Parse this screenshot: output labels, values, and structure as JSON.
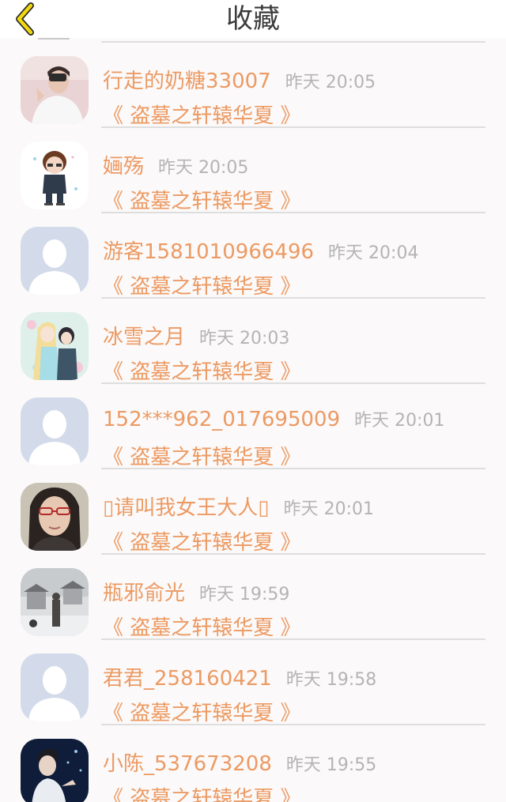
{
  "header": {
    "title": "收藏",
    "back_icon": "chevron-left-icon",
    "accent": "#f2d80f"
  },
  "colors": {
    "name": "#ec9a63",
    "time": "#b4b4b4",
    "separator": "#dedede"
  },
  "items": [
    {
      "name": "行走的奶糖33007",
      "time": "昨天 20:05",
      "book": "《 盗墓之轩辕华夏 》",
      "avatar": "photo-avatar"
    },
    {
      "name": "婳殇",
      "time": "昨天 20:05",
      "book": "《 盗墓之轩辕华夏 》",
      "avatar": "cartoon-avatar"
    },
    {
      "name": "游客1581010966496",
      "time": "昨天 20:04",
      "book": "《 盗墓之轩辕华夏 》",
      "avatar": "default-avatar"
    },
    {
      "name": "冰雪之月",
      "time": "昨天 20:03",
      "book": "《 盗墓之轩辕华夏 》",
      "avatar": "anime-avatar"
    },
    {
      "name": "152***962_017695009",
      "time": "昨天 20:01",
      "book": "《 盗墓之轩辕华夏 》",
      "avatar": "default-avatar"
    },
    {
      "name": "▯请叫我女王大人▯",
      "time": "昨天 20:01",
      "book": "《 盗墓之轩辕华夏 》",
      "avatar": "photo-avatar"
    },
    {
      "name": "瓶邪俞光",
      "time": "昨天 19:59",
      "book": "《 盗墓之轩辕华夏 》",
      "avatar": "snow-scene-avatar"
    },
    {
      "name": "君君_258160421",
      "time": "昨天 19:58",
      "book": "《 盗墓之轩辕华夏 》",
      "avatar": "default-avatar"
    },
    {
      "name": "小陈_537673208",
      "time": "昨天 19:55",
      "book": "《 盗墓之轩辕华夏 》",
      "avatar": "photo-avatar"
    }
  ]
}
